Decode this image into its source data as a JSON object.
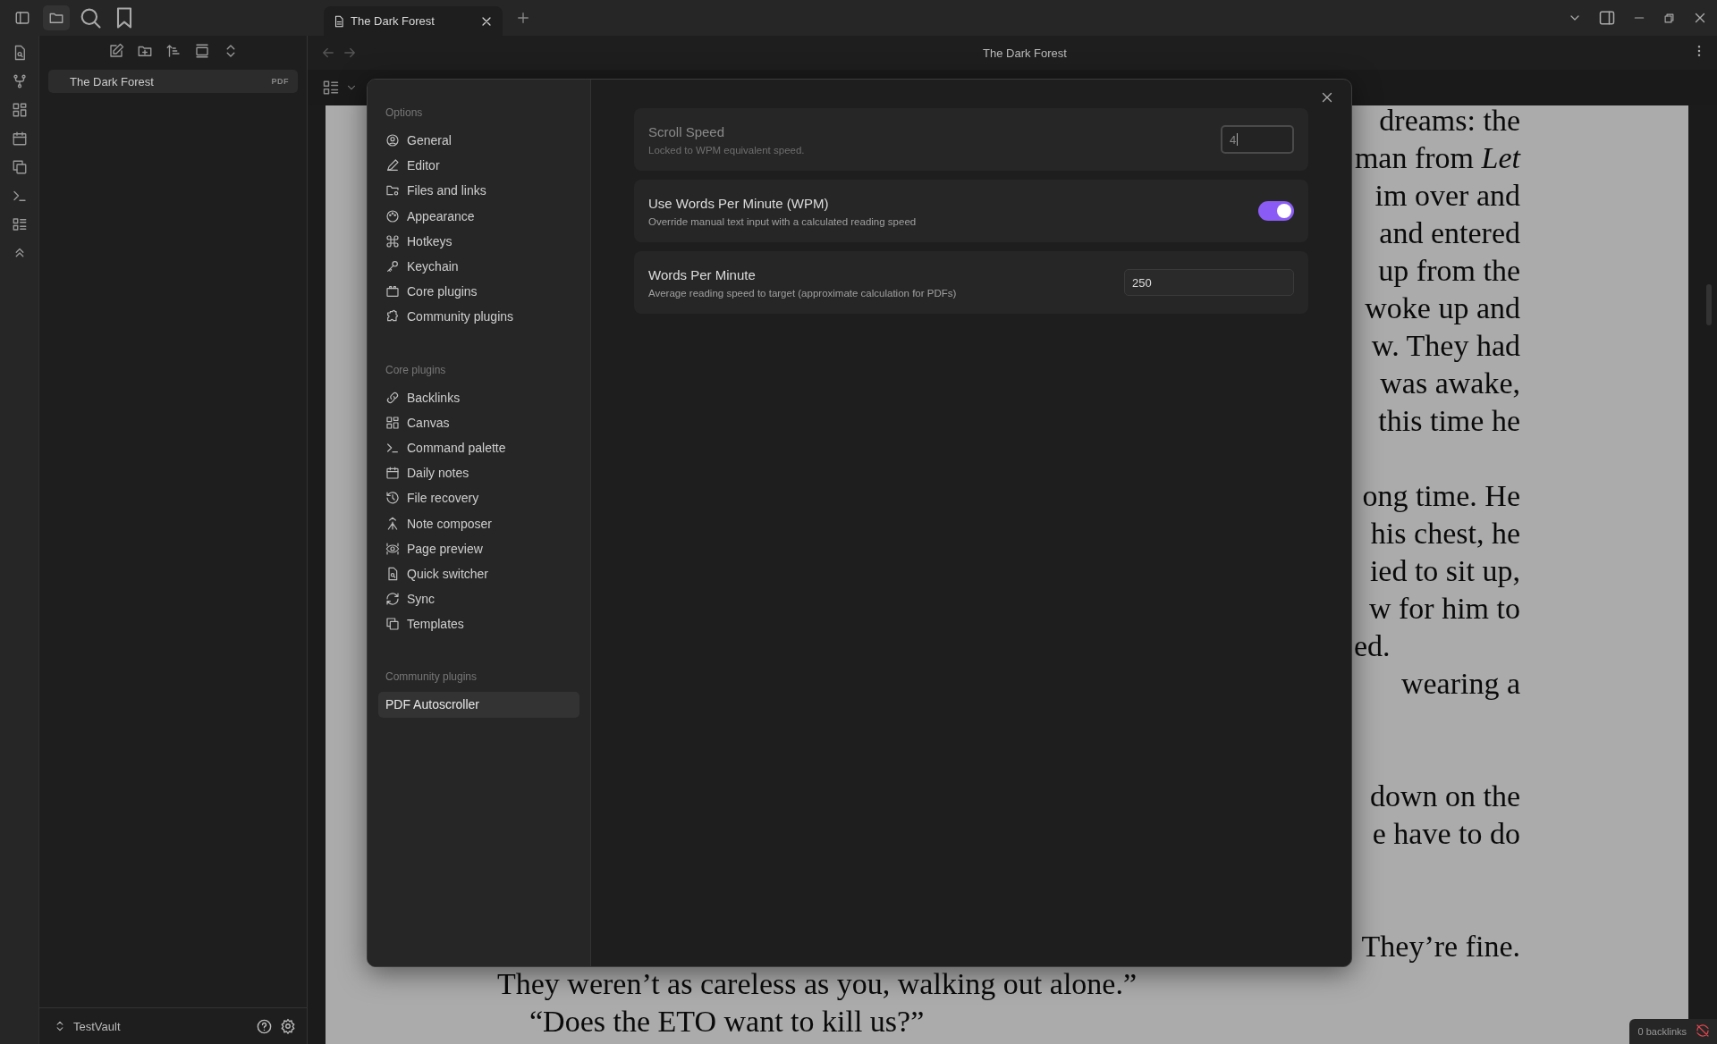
{
  "titlebar": {
    "tab": {
      "title": "The Dark Forest",
      "selected": true
    }
  },
  "sidebar": {
    "files": [
      {
        "name": "The Dark Forest",
        "badge": "PDF",
        "selected": true
      }
    ],
    "vault": "TestVault"
  },
  "view": {
    "title": "The Dark Forest"
  },
  "pdf": {
    "blocks": [
      {
        "lines": [
          {
            "kind": "right",
            "text": "dreams: the"
          },
          {
            "kind": "right",
            "text": "man from *Let*"
          },
          {
            "kind": "right",
            "text": "im over and"
          },
          {
            "kind": "right",
            "text": "and entered"
          },
          {
            "kind": "right",
            "text": "up from the"
          },
          {
            "kind": "right",
            "text": "woke up and"
          },
          {
            "kind": "right",
            "text": "w. They had"
          },
          {
            "kind": "right",
            "text": "was awake,"
          },
          {
            "kind": "right",
            "text": "this time he"
          }
        ]
      },
      {
        "lines": [
          {
            "kind": "right",
            "text": "ong time. He"
          },
          {
            "kind": "right",
            "text": "his chest, he"
          },
          {
            "kind": "right",
            "text": "ied to sit up,"
          },
          {
            "kind": "right",
            "text": "w for him to"
          },
          {
            "kind": "left",
            "text": "ed."
          },
          {
            "kind": "right",
            "text": "wearing a"
          }
        ]
      },
      {
        "lines": [
          {
            "kind": "right",
            "text": "down on the"
          },
          {
            "kind": "right",
            "text": "e have to do"
          }
        ]
      },
      {
        "lines": [
          {
            "kind": "right",
            "text": "They’re fine."
          },
          {
            "kind": "para",
            "text": "They weren’t as careless as you, walking out alone.”"
          },
          {
            "kind": "indent",
            "text": "“Does the ETO want to kill us?”"
          }
        ]
      }
    ]
  },
  "settings": {
    "nav": [
      {
        "heading": "Options",
        "items": [
          {
            "label": "General",
            "selected": false
          },
          {
            "label": "Editor",
            "selected": false
          },
          {
            "label": "Files and links",
            "selected": false
          },
          {
            "label": "Appearance",
            "selected": false
          },
          {
            "label": "Hotkeys",
            "selected": false
          },
          {
            "label": "Keychain",
            "selected": false
          },
          {
            "label": "Core plugins",
            "selected": false
          },
          {
            "label": "Community plugins",
            "selected": false
          }
        ]
      },
      {
        "heading": "Core plugins",
        "items": [
          {
            "label": "Backlinks",
            "selected": false
          },
          {
            "label": "Canvas",
            "selected": false
          },
          {
            "label": "Command palette",
            "selected": false
          },
          {
            "label": "Daily notes",
            "selected": false
          },
          {
            "label": "File recovery",
            "selected": false
          },
          {
            "label": "Note composer",
            "selected": false
          },
          {
            "label": "Page preview",
            "selected": false
          },
          {
            "label": "Quick switcher",
            "selected": false
          },
          {
            "label": "Sync",
            "selected": false
          },
          {
            "label": "Templates",
            "selected": false
          }
        ]
      },
      {
        "heading": "Community plugins",
        "items": [
          {
            "label": "PDF Autoscroller",
            "selected": true
          }
        ]
      }
    ],
    "options": [
      {
        "kind": "input",
        "name": "Scroll Speed",
        "description": "Locked to WPM equivalent speed.",
        "disabled": true,
        "focused": true,
        "value": "4"
      },
      {
        "kind": "toggle",
        "name": "Use Words Per Minute (WPM)",
        "description": "Override manual text input with a calculated reading speed",
        "on": true
      },
      {
        "kind": "input",
        "name": "Words Per Minute",
        "description": "Average reading speed to target (approximate calculation for PDFs)",
        "disabled": false,
        "focused": false,
        "value": "250"
      }
    ]
  },
  "status_bar": {
    "backlinks": "0 backlinks"
  }
}
